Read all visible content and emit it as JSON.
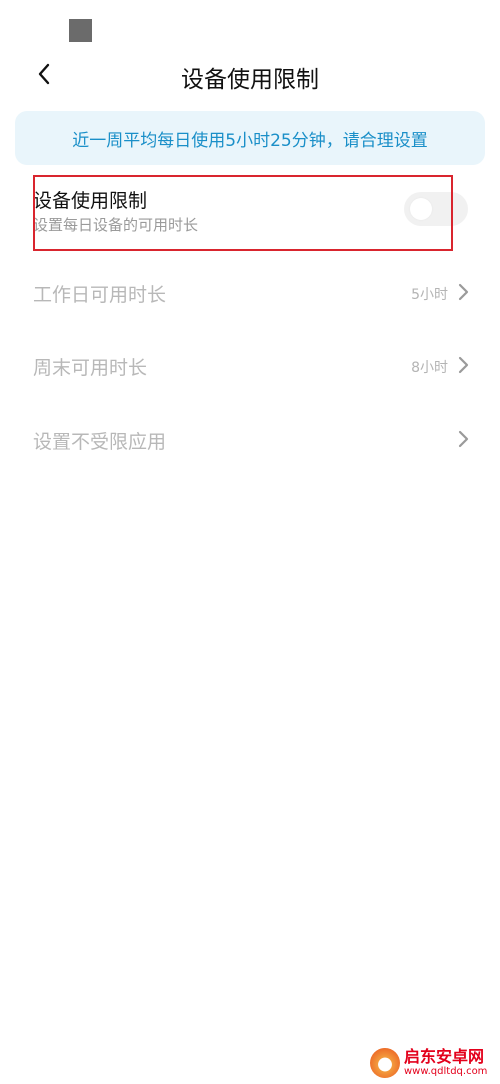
{
  "status_bar": {},
  "header": {
    "title": "设备使用限制"
  },
  "banner": {
    "text": "近一周平均每日使用5小时25分钟，请合理设置"
  },
  "limit_row": {
    "title": "设备使用限制",
    "subtitle": "设置每日设备的可用时长",
    "toggle_on": false
  },
  "rows": [
    {
      "label": "工作日可用时长",
      "value": "5小时"
    },
    {
      "label": "周末可用时长",
      "value": "8小时"
    },
    {
      "label": "设置不受限应用",
      "value": ""
    }
  ],
  "watermark": {
    "name": "启东安卓网",
    "url": "www.qdltdq.com"
  },
  "colors": {
    "banner_bg": "#e9f5fb",
    "banner_text": "#1a8fc8",
    "highlight": "#d9252e",
    "disabled_text": "#b8b8b8"
  }
}
